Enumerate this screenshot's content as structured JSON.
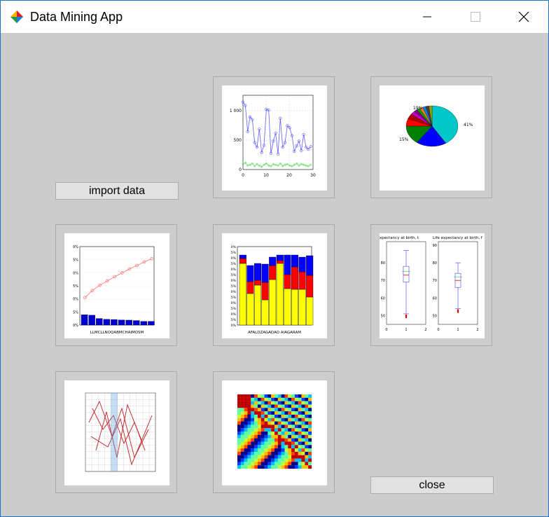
{
  "window": {
    "title": "Data Mining App"
  },
  "controls": {
    "import_label": "import data",
    "close_label": "close"
  },
  "tiles": {
    "line": {
      "y_ticks": [
        "1 000",
        "500",
        "0"
      ],
      "x_ticks": [
        "0",
        "10",
        "20",
        "30"
      ]
    },
    "pie": {
      "labels": [
        "19%",
        "41%",
        "15%"
      ]
    },
    "pareto": {
      "y_ticks": [
        "0%",
        "5%",
        "0%",
        "5%",
        "0%",
        "5%",
        "0%"
      ],
      "x_label": "LLMCLLNOQABMCHAIMOSM"
    },
    "stacked": {
      "y_ticks": [
        "0%",
        "5%",
        "0%",
        "5%",
        "0%",
        "5%",
        "0%",
        "5%",
        "0%",
        "5%",
        "0%",
        "5%",
        "0%",
        "5%",
        "0%"
      ],
      "x_label": "AFALDZAGADAO AIAGARAM"
    },
    "box": {
      "title_left": "xpectancy at birth, t",
      "title_right": "Life expectancy at birth, f",
      "left_y_ticks": [
        "80",
        "70",
        "60",
        "50"
      ],
      "right_y_ticks": [
        "90",
        "80",
        "70",
        "60",
        "50"
      ],
      "x_ticks": [
        "0",
        "1",
        "2"
      ]
    },
    "table": {},
    "heatmap": {}
  },
  "chart_data": [
    {
      "type": "line",
      "x": [
        0,
        1,
        2,
        3,
        4,
        5,
        6,
        7,
        8,
        9,
        10,
        11,
        12,
        13,
        14,
        15,
        16,
        17,
        18,
        19,
        20,
        21,
        22,
        23,
        24,
        25,
        26,
        27,
        28,
        29
      ],
      "series": [
        {
          "values": [
            1000,
            950,
            560,
            780,
            740,
            400,
            330,
            600,
            250,
            360,
            890,
            880,
            240,
            420,
            540,
            230,
            760,
            330,
            400,
            650,
            620,
            500,
            270,
            350,
            420,
            280,
            520,
            330,
            300,
            340
          ]
        },
        {
          "values": [
            80,
            100,
            60,
            70,
            90,
            50,
            80,
            60,
            40,
            70,
            90,
            60,
            50,
            80,
            70,
            60,
            90,
            50,
            70,
            80,
            60,
            50,
            70,
            90,
            60,
            80,
            70,
            60,
            50,
            70
          ]
        }
      ],
      "xlim": [
        0,
        30
      ],
      "ylim": [
        0,
        1100
      ]
    },
    {
      "type": "pie",
      "values": [
        41,
        19,
        15,
        6,
        4,
        3,
        2,
        2,
        2,
        2,
        2,
        2
      ],
      "colors": [
        "#00c8c8",
        "#0000ff",
        "#008000",
        "#ff0000",
        "#b00000",
        "#c000c0",
        "#800080",
        "#00a000",
        "#ff8000",
        "#0080ff",
        "#404040",
        "#a0a000"
      ]
    },
    {
      "type": "bar",
      "values": [
        50,
        48,
        32,
        28,
        27,
        25,
        24,
        22,
        18,
        18
      ],
      "cumulative": [
        50,
        70,
        85,
        97,
        109,
        120,
        131,
        141,
        151,
        160
      ]
    },
    {
      "type": "bar",
      "categories": [
        "AF",
        "AL",
        "DZ",
        "AG",
        "AD",
        "AO",
        "AI",
        "AG",
        "AR",
        "AM"
      ],
      "series": [
        {
          "name": "yellow",
          "values": [
            88,
            45,
            57,
            36,
            65,
            88,
            52,
            51,
            51,
            40
          ]
        },
        {
          "name": "red",
          "values": [
            7,
            17,
            7,
            25,
            20,
            4,
            20,
            32,
            25,
            31
          ]
        },
        {
          "name": "blue",
          "values": [
            5,
            23,
            24,
            26,
            12,
            8,
            28,
            17,
            21,
            28
          ]
        }
      ]
    },
    {
      "type": "box",
      "left": {
        "whisker_low": 51,
        "q1": 69,
        "median": 73,
        "q3": 78,
        "whisker_high": 87
      },
      "right": {
        "whisker_low": 54,
        "q1": 66,
        "median": 70,
        "q3": 74,
        "whisker_high": 80
      }
    },
    {
      "type": "table"
    },
    {
      "type": "heatmap"
    }
  ]
}
